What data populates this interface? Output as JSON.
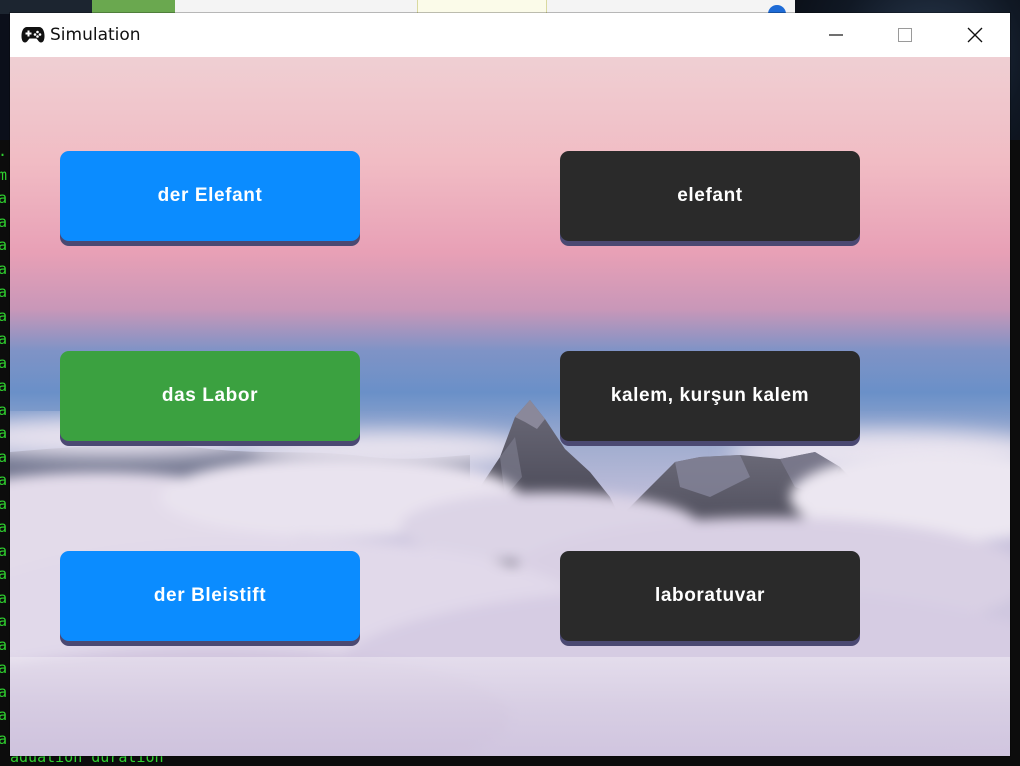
{
  "window": {
    "title": "Simulation",
    "icon": "gamepad-icon",
    "controls": [
      "minimize-icon",
      "maximize-icon",
      "close-icon"
    ]
  },
  "background": {
    "description_colors": {
      "sky_top": "#f0c9cf",
      "sky_mid": "#e9a4b8",
      "sky_low": "#5e8ccb",
      "clouds": "#d9d2e4"
    }
  },
  "cards": {
    "left": [
      {
        "label": "der Elefant",
        "color": "#0b8cff"
      },
      {
        "label": "das Labor",
        "color": "#3ba140"
      },
      {
        "label": "der Bleistift",
        "color": "#0b8cff"
      }
    ],
    "right": [
      {
        "label": "elefant",
        "color": "#2a2a2a"
      },
      {
        "label": "kalem, kurşun kalem",
        "color": "#2a2a2a"
      },
      {
        "label": "laboratuvar",
        "color": "#2a2a2a"
      }
    ]
  },
  "desktop": {
    "terminal_glyphs": [
      ".",
      "m",
      "a",
      "a",
      "a",
      "a",
      "a",
      "a",
      "a",
      "a",
      "a",
      "a",
      "a",
      "a",
      "a",
      "a",
      "a",
      "a",
      "a",
      "a",
      "a",
      "a",
      "a",
      "a",
      "a",
      "a",
      "a"
    ],
    "terminal_bottom_text": "aduation duration"
  }
}
